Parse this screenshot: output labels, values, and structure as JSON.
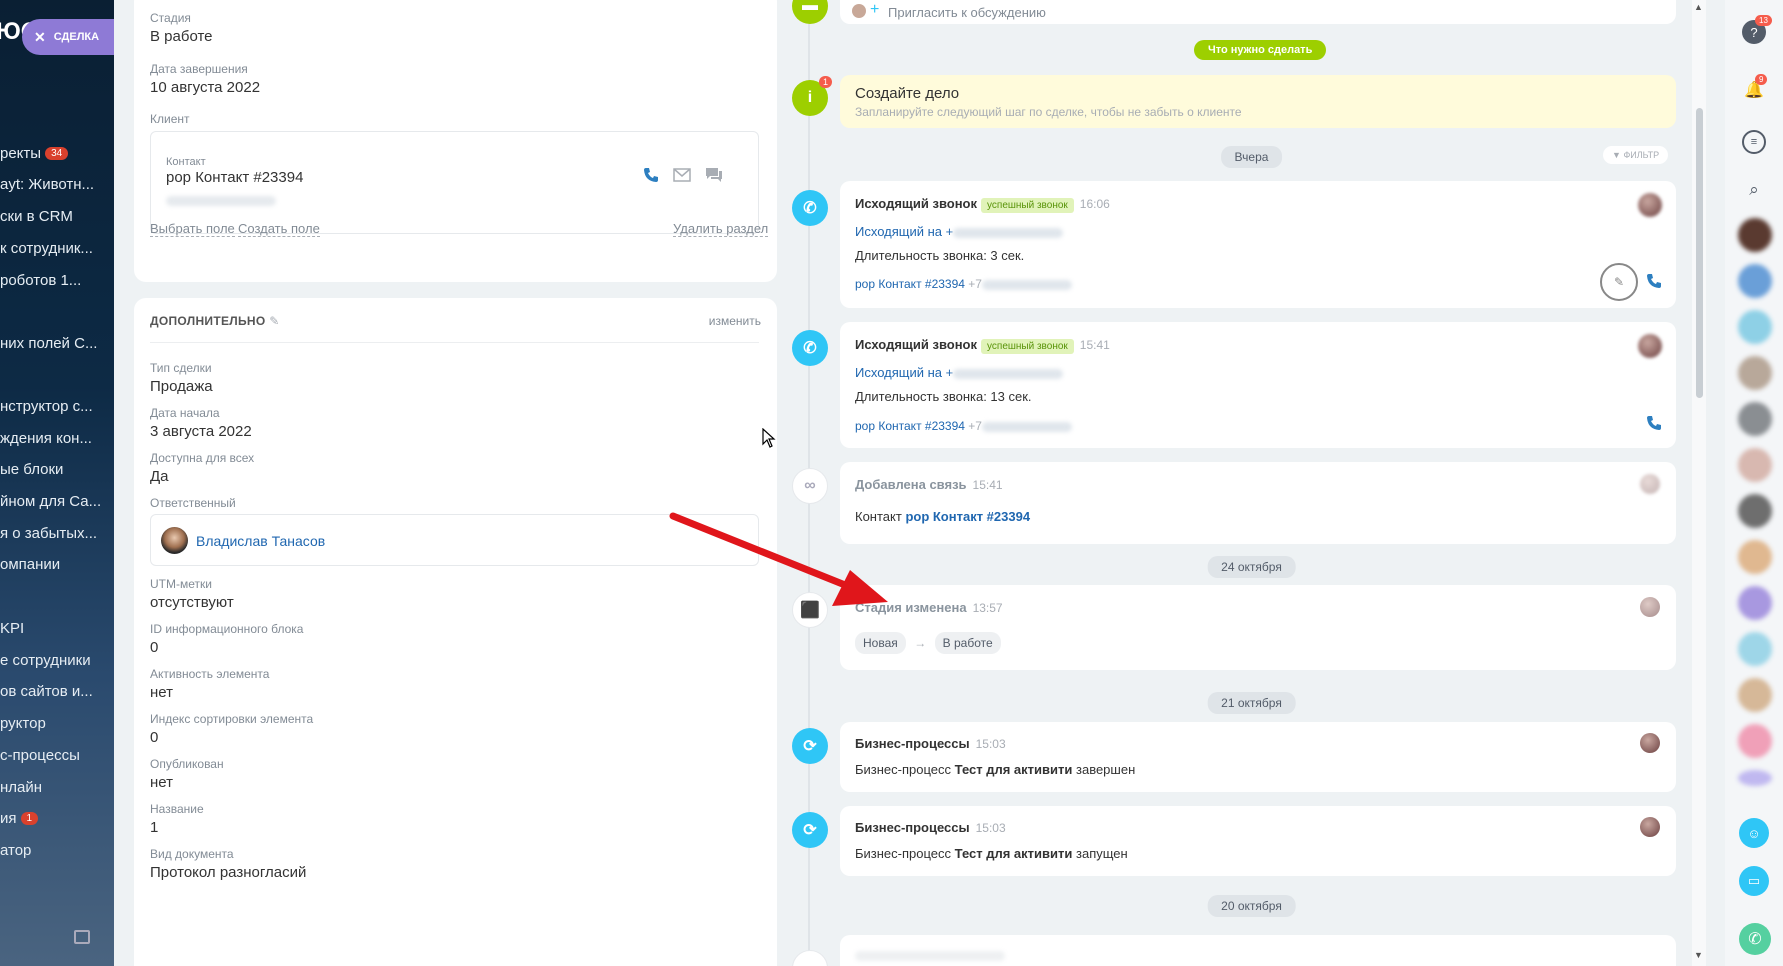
{
  "leftnav": {
    "logo": "ЮО",
    "deal_pill": "СДЕЛКА",
    "items": [
      {
        "label": "ректы",
        "badge": "34"
      },
      {
        "label": "ayt: Животн..."
      },
      {
        "label": "ски в CRM"
      },
      {
        "label": "к сотрудник..."
      },
      {
        "label": " роботов 1..."
      },
      {
        "label": ""
      },
      {
        "label": "них полей С..."
      },
      {
        "label": ""
      },
      {
        "label": "нструктор с..."
      },
      {
        "label": "ждения кон..."
      },
      {
        "label": "ые блоки"
      },
      {
        "label": "йном для Са..."
      },
      {
        "label": "я о забытых..."
      },
      {
        "label": "омпании"
      },
      {
        "label": ""
      },
      {
        "label": "KPI"
      },
      {
        "label": "е сотрудники"
      },
      {
        "label": "ов сайтов и..."
      },
      {
        "label": "руктор"
      },
      {
        "label": "с-процессы"
      },
      {
        "label": "нлайн"
      },
      {
        "label": "ия",
        "badge": "1"
      },
      {
        "label": "атор"
      }
    ]
  },
  "main_card": {
    "stage_label": "Стадия",
    "stage_value": "В работе",
    "close_date_label": "Дата завершения",
    "close_date_value": "10 августа 2022",
    "client_label": "Клиент",
    "contact_label": "Контакт",
    "contact_name": "рор Контакт #23394",
    "contact_phone": "+7 000 000 00 00",
    "select_field": "Выбрать поле",
    "create_field": "Создать поле",
    "delete_section": "Удалить раздел"
  },
  "extra_card": {
    "title": "ДОПОЛНИТЕЛЬНО",
    "edit": "изменить",
    "fields": [
      {
        "label": "Тип сделки",
        "value": "Продажа"
      },
      {
        "label": "Дата начала",
        "value": "3 августа 2022"
      },
      {
        "label": "Доступна для всех",
        "value": "Да"
      },
      {
        "label": "Ответственный",
        "value": "Владислав Танасов"
      },
      {
        "label": "UTM-метки",
        "value": "отсутствуют"
      },
      {
        "label": "ID информационного блока",
        "value": "0"
      },
      {
        "label": "Активность элемента",
        "value": "нет"
      },
      {
        "label": "Индекс сортировки элемента",
        "value": "0"
      },
      {
        "label": "Опубликован",
        "value": "нет"
      },
      {
        "label": "Название",
        "value": "1"
      },
      {
        "label": "Вид документа",
        "value": "Протокол разногласий"
      }
    ]
  },
  "timeline": {
    "invite": "Пригласить к обсуждению",
    "todo_pill": "Что нужно сделать",
    "todo_count": "1",
    "todo_title": "Создайте дело",
    "todo_hint": "Запланируйте следующий шаг по сделке, чтобы не забыть о клиенте",
    "filter": "ФИЛЬТР",
    "dates": [
      "Вчера",
      "24 октября",
      "21 октября",
      "20 октября"
    ],
    "call1": {
      "title": "Исходящий звонок",
      "badge": "успешный звонок",
      "time": "16:06",
      "line1": "Исходящий на",
      "plus": "+",
      "duration": "Длительность звонка: 3 сек.",
      "contact": "рор Контакт #23394",
      "contact_plus": "+7"
    },
    "call2": {
      "title": "Исходящий звонок",
      "badge": "успешный звонок",
      "time": "15:41",
      "line1": "Исходящий на",
      "plus": "+",
      "duration": "Длительность звонка: 13 сек.",
      "contact": "рор Контакт #23394",
      "contact_plus": "+7"
    },
    "link_added": {
      "title": "Добавлена связь",
      "time": "15:41",
      "prefix": "Контакт",
      "contact": "рор Контакт #23394"
    },
    "stage_changed": {
      "title": "Стадия изменена",
      "time": "13:57",
      "from": "Новая",
      "arrow": "→",
      "to": "В работе"
    },
    "bp1": {
      "title": "Бизнес-процессы",
      "time": "15:03",
      "prefix": "Бизнес-процесс",
      "name": "Тест для активити",
      "suffix": "завершен"
    },
    "bp2": {
      "title": "Бизнес-процессы",
      "time": "15:03",
      "prefix": "Бизнес-процесс",
      "name": "Тест для активити",
      "suffix": "запущен"
    }
  },
  "rightbar": {
    "help_count": "13",
    "notif_count": "9"
  },
  "colors": {
    "accent_blue": "#2fc6f6",
    "todo_green": "#9dcf00",
    "annotation_arrow": "#e0161b",
    "deal_pill": "#8e7ad6"
  }
}
